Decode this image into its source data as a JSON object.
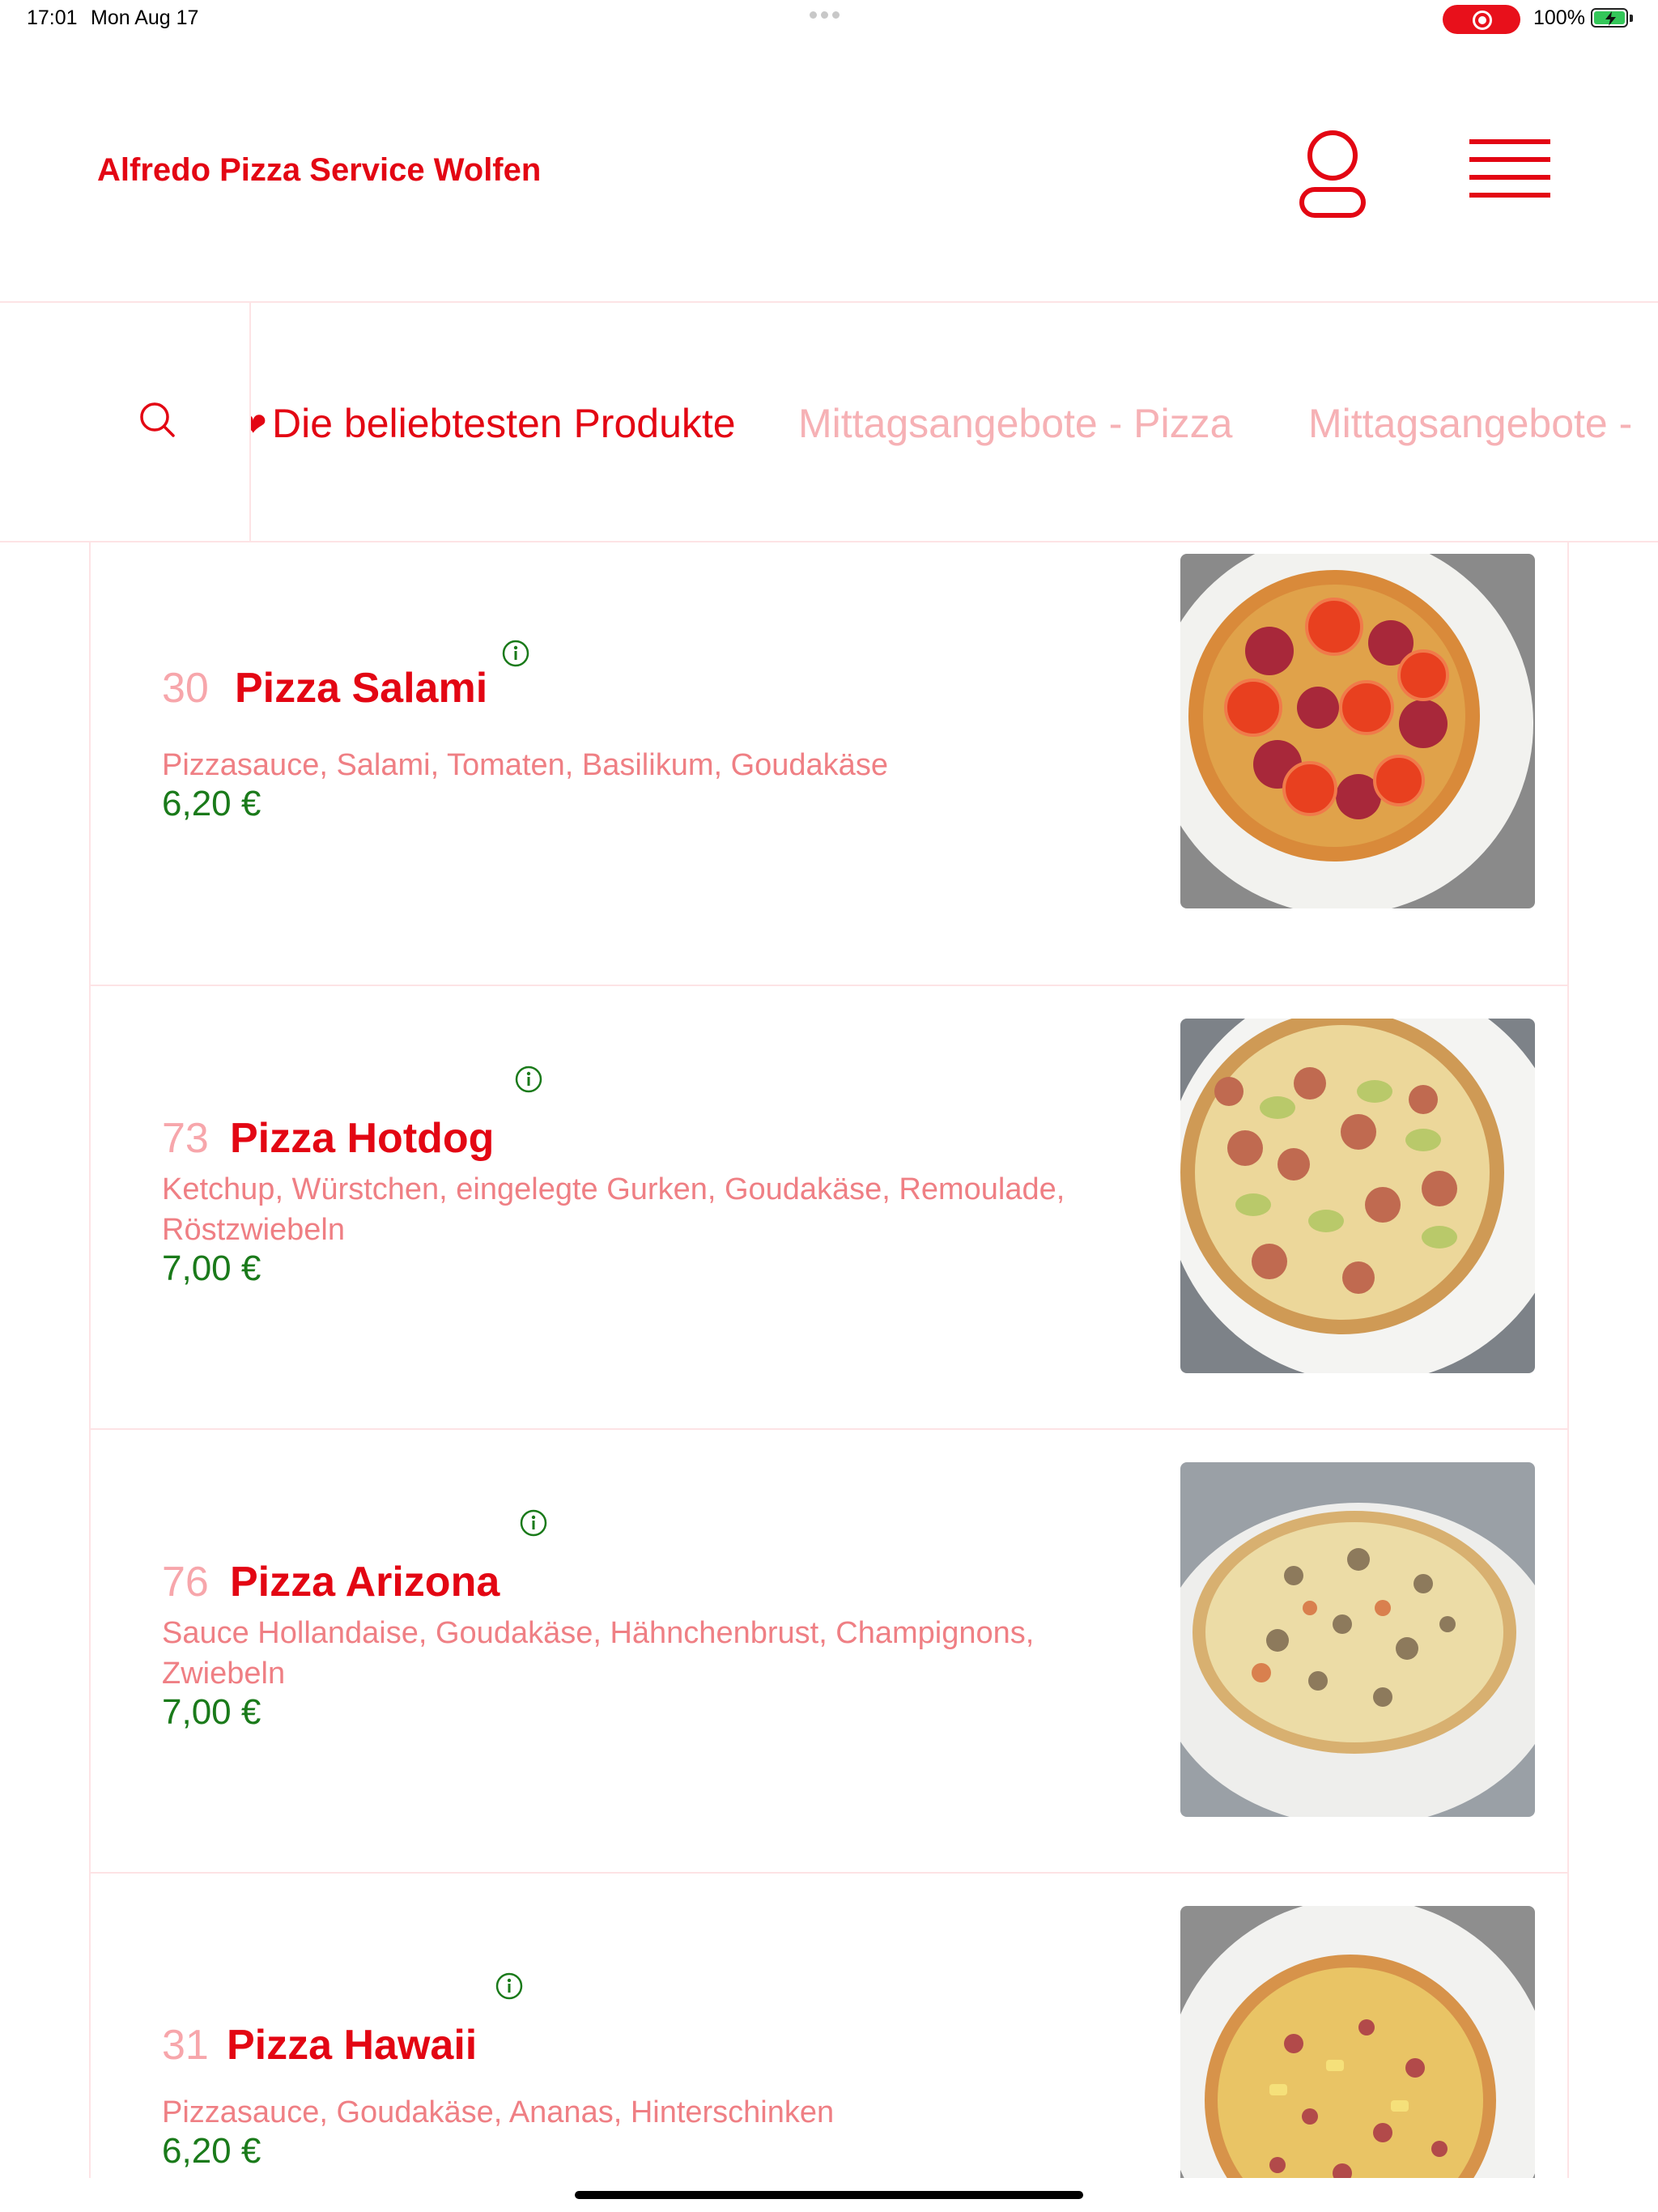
{
  "status_bar": {
    "time": "17:01",
    "date": "Mon Aug 17",
    "battery": "100%"
  },
  "header": {
    "title": "Alfredo Pizza Service Wolfen",
    "user_icon": "user-icon",
    "menu_icon": "hamburger-menu-icon"
  },
  "categories": {
    "search_icon": "search-icon",
    "items": [
      "Die beliebtesten Produkte",
      "Mittagsangebote -  Pizza",
      "Mittagsangebote -"
    ],
    "active_index": 0
  },
  "products": [
    {
      "number": "30",
      "name": "Pizza Salami",
      "description": "Pizzasauce, Salami, Tomaten, Basilikum, Goudakäse",
      "price": "6,20 €"
    },
    {
      "number": "73",
      "name": "Pizza Hotdog",
      "description": "Ketchup, Würstchen, eingelegte Gurken, Goudakäse, Remoulade, Röstzwiebeln",
      "price": "7,00 €"
    },
    {
      "number": "76",
      "name": "Pizza Arizona",
      "description": "Sauce Hollandaise, Goudakäse, Hähnchenbrust, Champignons, Zwiebeln",
      "price": "7,00 €"
    },
    {
      "number": "31",
      "name": "Pizza Hawaii",
      "description": "Pizzasauce, Goudakäse, Ananas, Hinterschinken",
      "price": "6,20 €"
    }
  ],
  "colors": {
    "brand": "#e30613",
    "inactive_category": "#f6b1b5",
    "price": "#1a7a1a",
    "description": "#ef7f84"
  }
}
